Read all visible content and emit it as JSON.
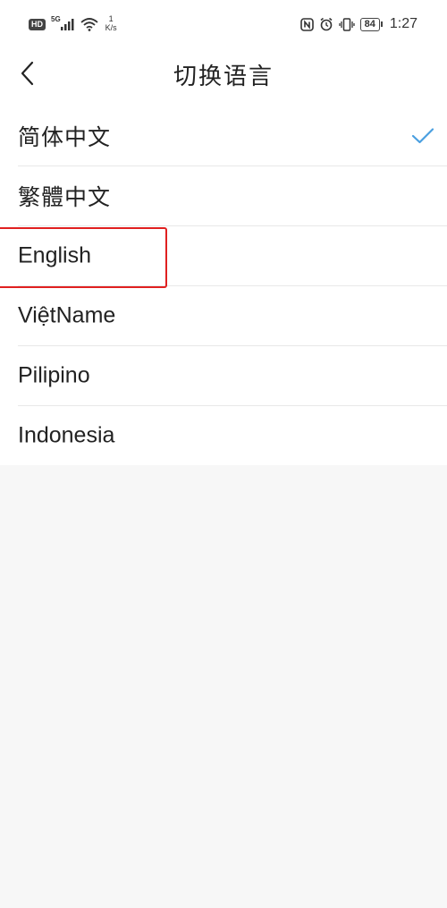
{
  "status_bar": {
    "hd_label": "HD",
    "network_type": "5G",
    "speed_value": "1",
    "speed_unit": "K/s",
    "battery_level": "84",
    "time": "1:27",
    "icons": [
      "hd-icon",
      "signal-icon",
      "wifi-icon",
      "nfc-icon",
      "alarm-icon",
      "vibrate-icon",
      "battery-icon"
    ]
  },
  "header": {
    "title": "切换语言",
    "back_icon": "chevron-left-icon"
  },
  "languages": [
    {
      "label": "简体中文",
      "selected": true
    },
    {
      "label": "繁體中文",
      "selected": false
    },
    {
      "label": "English",
      "selected": false,
      "highlighted": true
    },
    {
      "label": "ViệtName",
      "selected": false
    },
    {
      "label": "Pilipino",
      "selected": false
    },
    {
      "label": "Indonesia",
      "selected": false
    }
  ],
  "colors": {
    "check": "#4a9fe0",
    "highlight": "#e02020",
    "list_bg": "#ffffff",
    "page_bg": "#f7f7f7",
    "divider": "#e8e8e8"
  }
}
